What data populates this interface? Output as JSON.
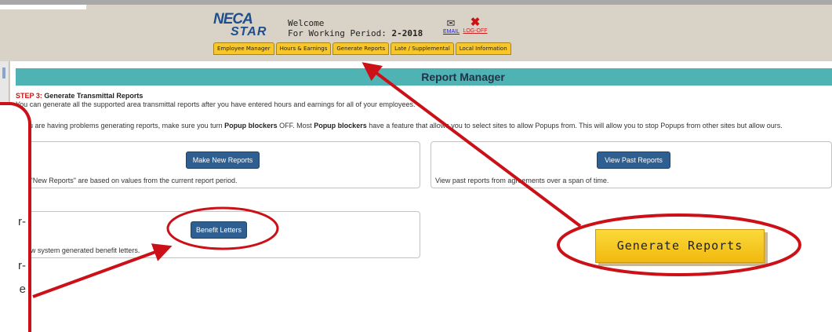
{
  "header": {
    "logo_top": "NECA",
    "logo_bottom": "STAR",
    "welcome": "Welcome",
    "period_label": "For Working Period:",
    "period_value": "2-2018",
    "email_label": "EMAIL",
    "logoff_label": "LOG-OFF"
  },
  "nav_tabs": [
    "Employee Manager",
    "Hours & Earnings",
    "Generate Reports",
    "Late / Supplemental",
    "Local Information"
  ],
  "page": {
    "title": "Report Manager",
    "step_label": "STEP 3:",
    "step_title": "Generate Transmittal Reports",
    "description": "You can generate all the supported area transmittal reports after you have entered hours and earnings for all of your employees.",
    "popup_part1": "If you are having problems generating reports, make sure you turn ",
    "popup_bold1": "Popup blockers",
    "popup_part2": " OFF. Most ",
    "popup_bold2": "Popup blockers",
    "popup_part3": " have a feature that allows you to select sites to allow Popups from. This will allow you to stop Popups from other sites but allow ours."
  },
  "cards": {
    "new_reports": {
      "button": "Make New Reports",
      "description": "All \"New Reports\" are based on values from the current report period."
    },
    "past_reports": {
      "button": "View Past Reports",
      "description": "View past reports from agreements over a span of time."
    },
    "benefit_letters": {
      "button": "Benefit Letters",
      "description": "View system generated benefit letters."
    }
  },
  "callout": {
    "zoom_label": "Generate Reports",
    "side_fragments": [
      "r-",
      "r-",
      "e"
    ]
  },
  "colors": {
    "accent_teal": "#4fb2b3",
    "button_blue": "#2f5f91",
    "tab_yellow": "#f7c62b",
    "annotation_red": "#cc1018"
  }
}
